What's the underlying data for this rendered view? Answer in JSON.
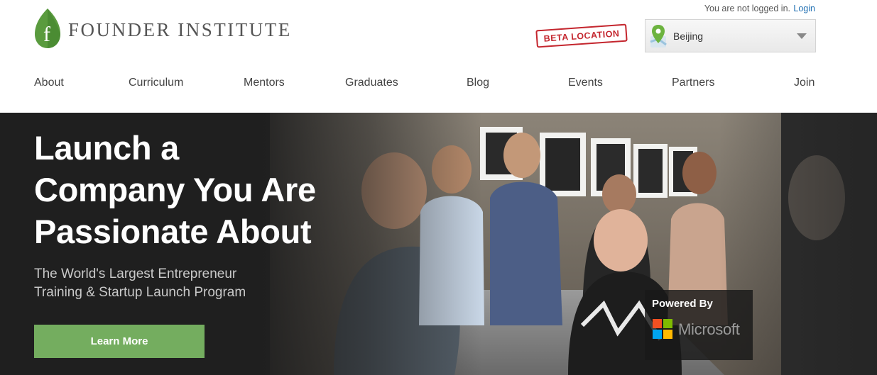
{
  "brand": {
    "name": "FOUNDER INSTITUTE",
    "logo_letter": "f",
    "accent": "#5a9b3e"
  },
  "auth": {
    "status_text": "You are not logged in.",
    "login_label": "Login"
  },
  "beta_badge": "BETA LOCATION",
  "location": {
    "selected": "Beijing"
  },
  "nav": {
    "items": [
      {
        "label": "About"
      },
      {
        "label": "Curriculum"
      },
      {
        "label": "Mentors"
      },
      {
        "label": "Graduates"
      },
      {
        "label": "Blog"
      },
      {
        "label": "Events"
      },
      {
        "label": "Partners"
      },
      {
        "label": "Join"
      }
    ]
  },
  "hero": {
    "headline_lines": [
      "Launch a",
      "Company You Are",
      "Passionate About"
    ],
    "subhead_lines": [
      "The World's Largest Entrepreneur",
      "Training & Startup Launch Program"
    ],
    "cta_label": "Learn More",
    "cta_color": "#74ad5f"
  },
  "sponsor": {
    "label": "Powered By",
    "name": "Microsoft",
    "colors": [
      "#f25022",
      "#7fba00",
      "#00a4ef",
      "#ffb900"
    ]
  }
}
